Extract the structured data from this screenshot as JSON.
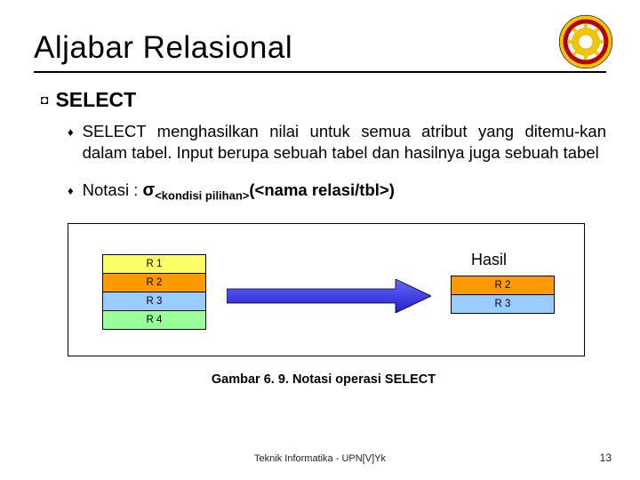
{
  "title": "Aljabar Relasional",
  "section_label": "SELECT",
  "bullets": {
    "b1": "SELECT menghasilkan nilai untuk semua atribut yang ditemu-kan dalam tabel. Input berupa sebuah tabel dan hasilnya juga sebuah tabel",
    "b2_prefix": "Notasi : ",
    "b2_sigma": "σ",
    "b2_sub": "<kondisi pilihan>",
    "b2_paren": "(<nama relasi/tbl>)"
  },
  "left_rows": [
    "R 1",
    "R 2",
    "R 3",
    "R 4"
  ],
  "right_rows": [
    "R 2",
    "R 3"
  ],
  "hasil_label": "Hasil",
  "caption": "Gambar 6. 9. Notasi operasi SELECT",
  "footer_center": "Teknik Informatika - UPN[V]Yk",
  "page_number": "13",
  "colors": {
    "yellow": "#fcff66",
    "orange": "#ff9900",
    "blue": "#99ccff",
    "green": "#99ff99",
    "arrow": "#3333ff"
  },
  "logo": {
    "ring_outer": "#f5c400",
    "ring_inner": "#b80000",
    "gear": "#f5c400",
    "center": "#ffffff"
  }
}
